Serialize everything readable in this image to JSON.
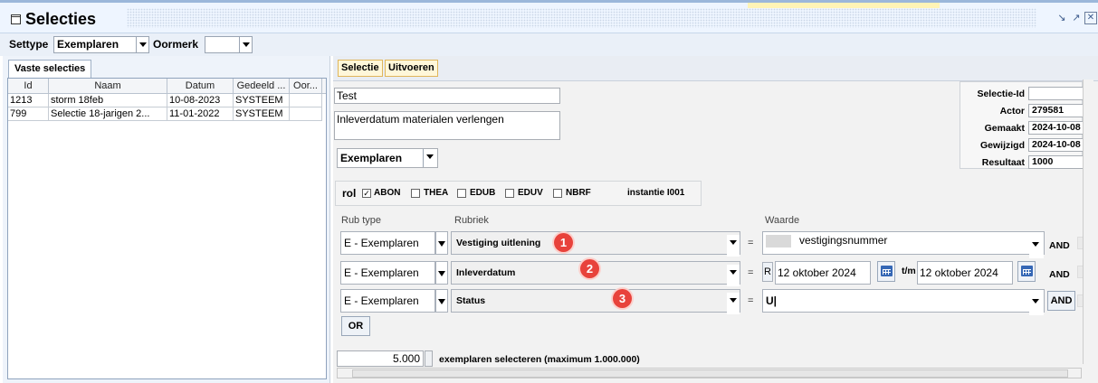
{
  "window": {
    "title": "Selecties"
  },
  "settype_bar": {
    "settype_label": "Settype",
    "settype_value": "Exemplaren",
    "oormerk_label": "Oormerk",
    "oormerk_value": ""
  },
  "left": {
    "tab": "Vaste selecties",
    "columns": [
      "Id",
      "Naam",
      "Datum",
      "Gedeeld ...",
      "Oor..."
    ],
    "rows": [
      {
        "id": "1213",
        "naam": "storm 18feb",
        "datum": "10-08-2023",
        "gedeeld": "SYSTEEM",
        "oor": ""
      },
      {
        "id": "799",
        "naam": "Selectie 18-jarigen 2...",
        "datum": "11-01-2022",
        "gedeeld": "SYSTEEM",
        "oor": ""
      }
    ]
  },
  "right": {
    "tabs": [
      "Selectie",
      "Uitvoeren"
    ],
    "name": "Test",
    "description": "Inleverdatum materialen verlengen",
    "type_value": "Exemplaren",
    "info": {
      "selectie_id_label": "Selectie-Id",
      "selectie_id": "",
      "actor_label": "Actor",
      "actor": "279581",
      "gemaakt_label": "Gemaakt",
      "gemaakt": "2024-10-08",
      "gewijzigd_label": "Gewijzigd",
      "gewijzigd": "2024-10-08",
      "resultaat_label": "Resultaat",
      "resultaat": "1000"
    },
    "rol": {
      "label": "rol",
      "options": [
        {
          "label": "ABON",
          "checked": true
        },
        {
          "label": "THEA",
          "checked": false
        },
        {
          "label": "EDUB",
          "checked": false
        },
        {
          "label": "EDUV",
          "checked": false
        },
        {
          "label": "NBRF",
          "checked": false
        }
      ],
      "instantie": "instantie I001"
    },
    "headers": {
      "rub_type": "Rub type",
      "rubriek": "Rubriek",
      "waarde": "Waarde"
    },
    "criteria": [
      {
        "rub_type": "E - Exemplaren",
        "rubriek": "Vestiging uitlening",
        "badge": "1",
        "op": "=",
        "value": "vestigingsnummer",
        "connector": "AND"
      },
      {
        "rub_type": "E - Exemplaren",
        "rubriek": "Inleverdatum",
        "badge": "2",
        "op": "=",
        "prefix": "R",
        "from": "12 oktober 2024",
        "tm": "t/m",
        "to": "12 oktober 2024",
        "connector": "AND"
      },
      {
        "rub_type": "E - Exemplaren",
        "rubriek": "Status",
        "badge": "3",
        "op": "=",
        "value": "U|",
        "connector": "AND"
      }
    ],
    "or_label": "OR",
    "count_value": "5.000",
    "count_text": "exemplaren selecteren (maximum 1.000.000)"
  }
}
